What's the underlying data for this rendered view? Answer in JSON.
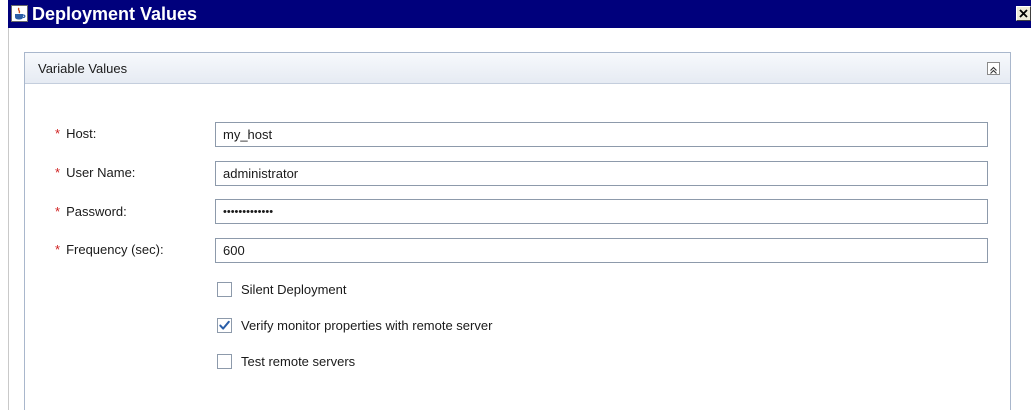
{
  "window": {
    "title": "Deployment Values"
  },
  "panel": {
    "title": "Variable Values"
  },
  "fields": {
    "host": {
      "label": "Host:",
      "value": "my_host"
    },
    "user_name": {
      "label": "User Name:",
      "value": "administrator"
    },
    "password": {
      "label": "Password:",
      "value": "•••••••••••••"
    },
    "frequency": {
      "label": "Frequency (sec):",
      "value": "600"
    }
  },
  "required_marker": "*",
  "options": {
    "silent_deployment": {
      "label": "Silent Deployment",
      "checked": false
    },
    "verify_monitor": {
      "label": "Verify monitor properties with remote server",
      "checked": true
    },
    "test_remote": {
      "label": "Test remote servers",
      "checked": false
    }
  },
  "colors": {
    "titlebar": "#00007c",
    "required": "#d02020",
    "checkmark": "#2a5ea8"
  },
  "icons": {
    "app": "java-cup-icon",
    "close": "close-icon",
    "collapse": "collapse-up-icon"
  }
}
